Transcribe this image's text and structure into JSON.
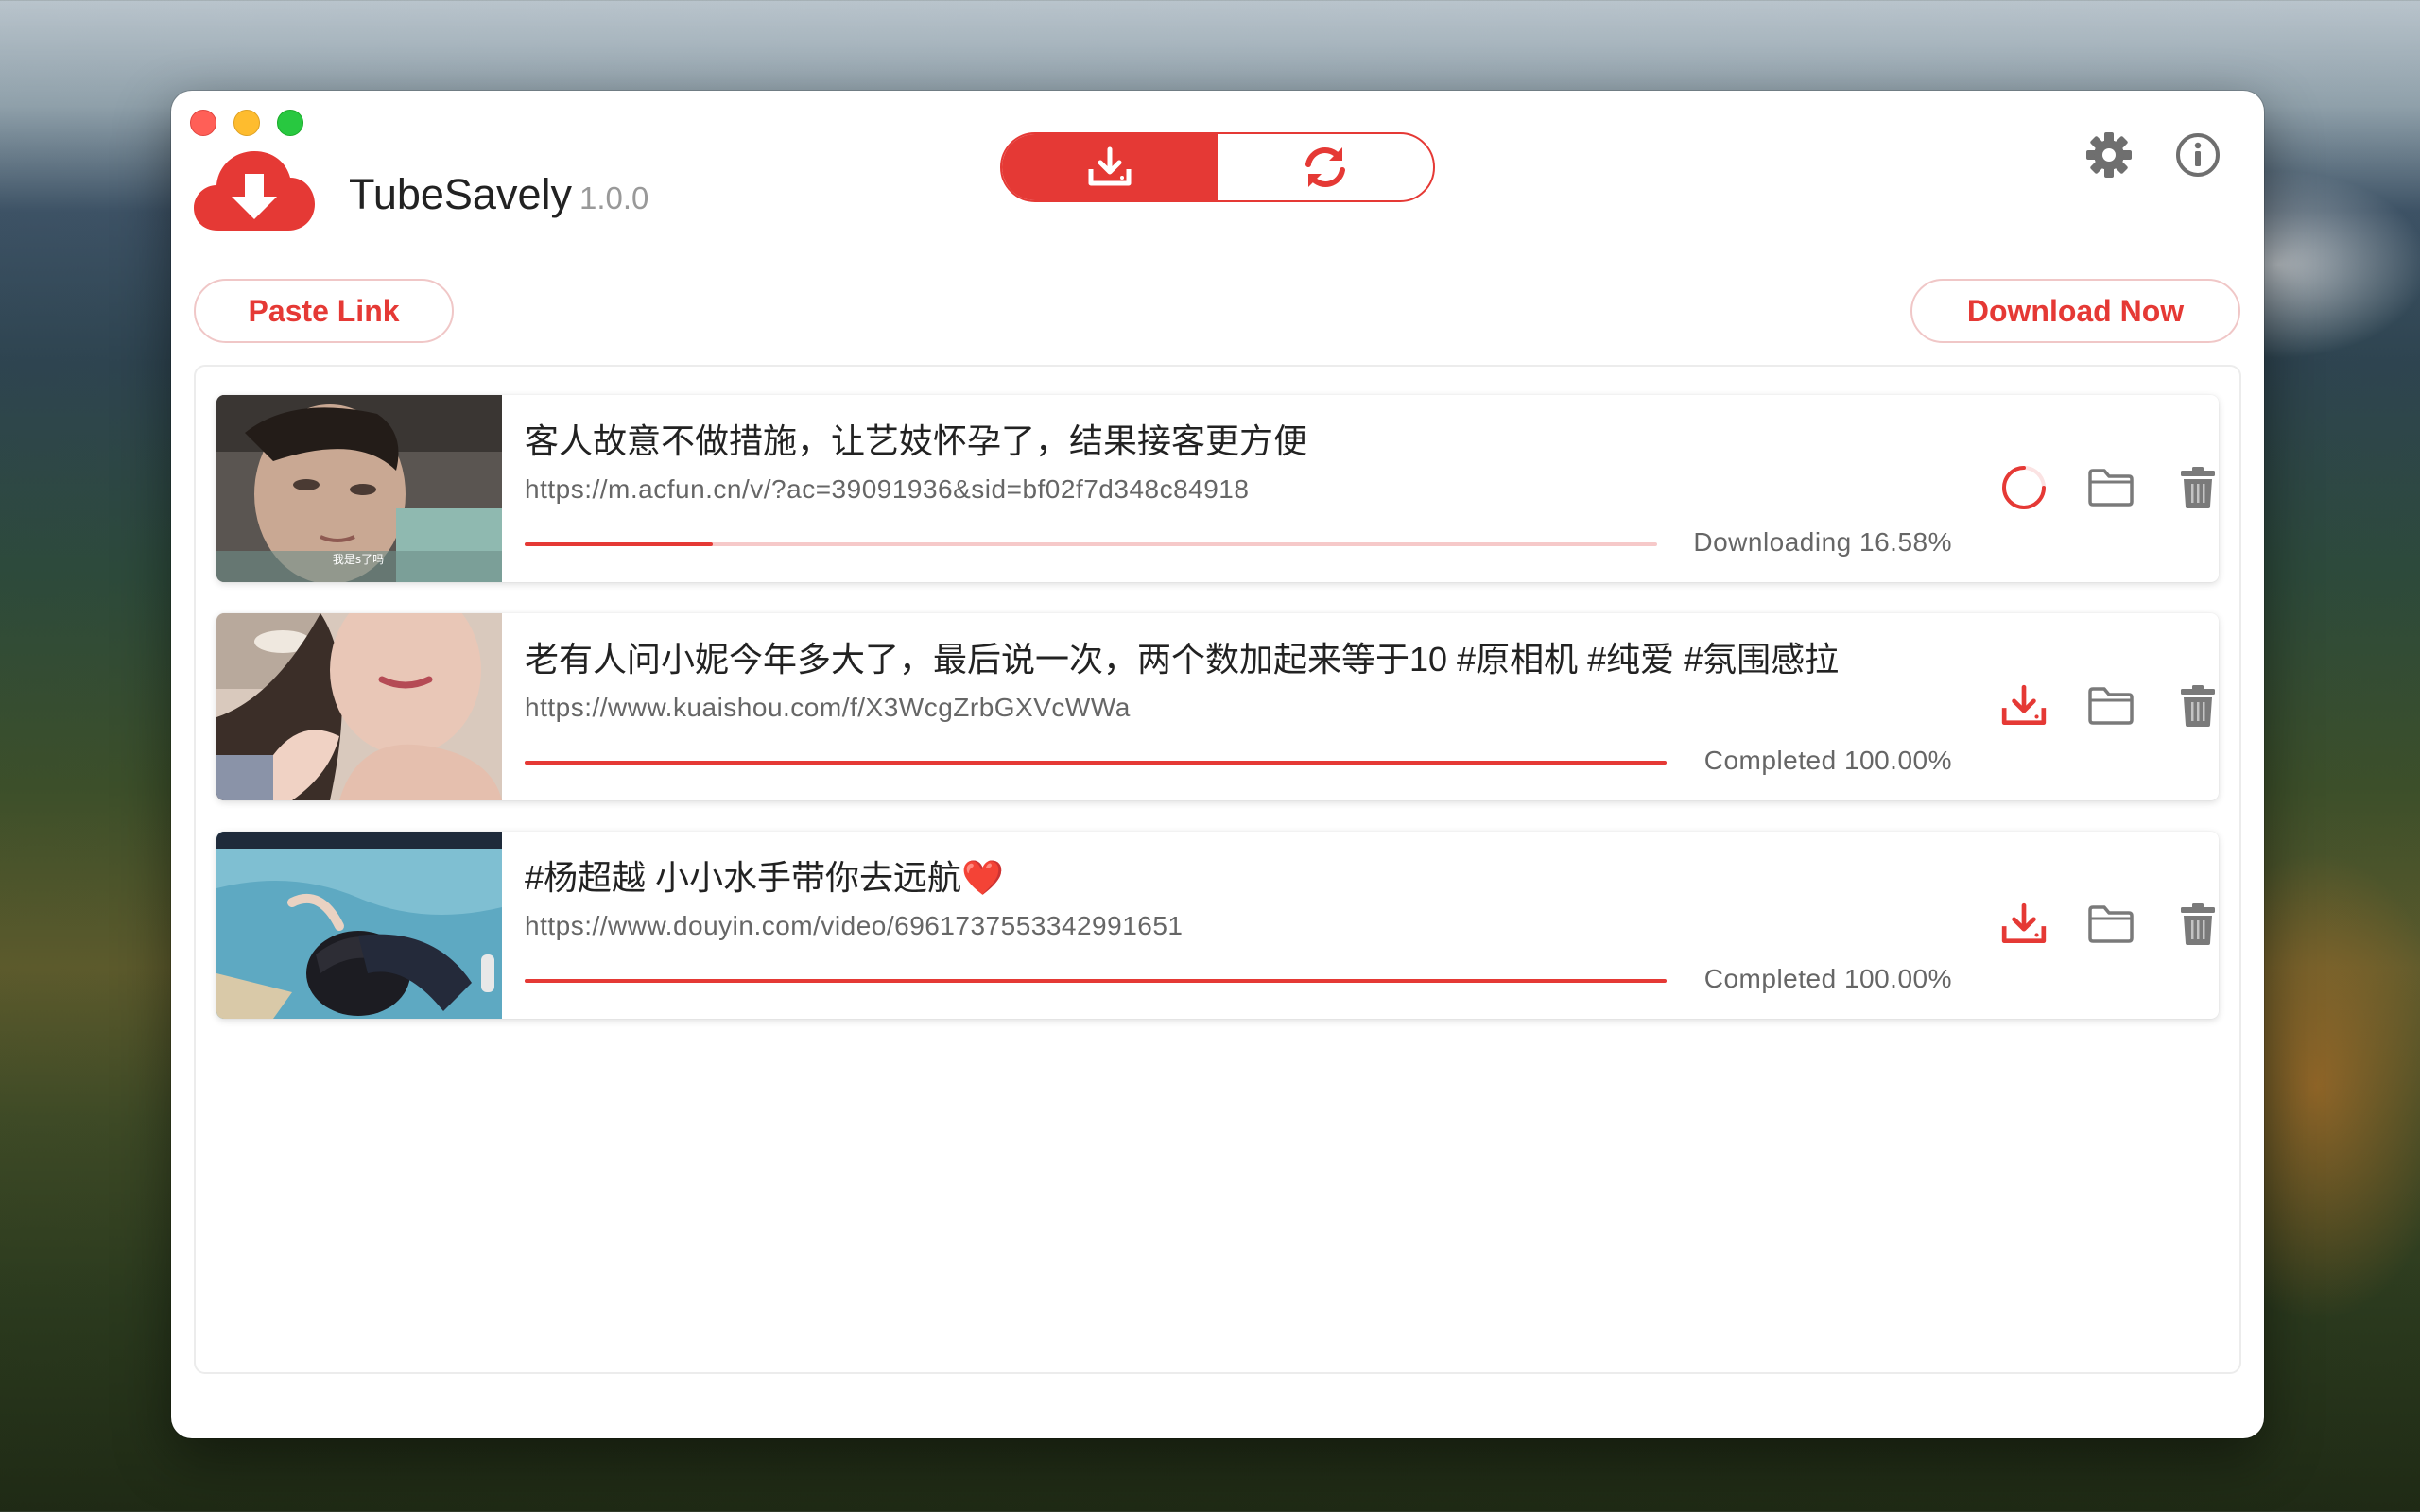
{
  "app": {
    "name": "TubeSavely",
    "version": "1.0.0"
  },
  "header": {
    "tabs": [
      {
        "icon": "download-tray-icon",
        "active": true
      },
      {
        "icon": "sync-icon",
        "active": false
      }
    ],
    "right_icons": [
      "gear-icon",
      "info-icon"
    ]
  },
  "toolbar": {
    "paste_label": "Paste Link",
    "download_label": "Download Now"
  },
  "colors": {
    "accent": "#e53935",
    "track": "#f6c9c9"
  },
  "downloads": [
    {
      "title": "客人故意不做措施，让艺妓怀孕了，结果接客更方便",
      "url": "https://m.acfun.cn/v/?ac=39091936&sid=bf02f7d348c84918",
      "status": "Downloading 16.58%",
      "progress": 0.1658,
      "state": "downloading",
      "thumb_caption": "我是s了吗"
    },
    {
      "title": "老有人问小妮今年多大了，最后说一次，两个数加起来等于10 #原相机 #纯爱 #氛围感拉",
      "url": "https://www.kuaishou.com/f/X3WcgZrbGXVcWWa",
      "status": "Completed 100.00%",
      "progress": 1.0,
      "state": "completed"
    },
    {
      "title": "#杨超越  小小水手带你去远航❤️",
      "url": "https://www.douyin.com/video/6961737553342991651",
      "status": "Completed 100.00%",
      "progress": 1.0,
      "state": "completed"
    }
  ]
}
